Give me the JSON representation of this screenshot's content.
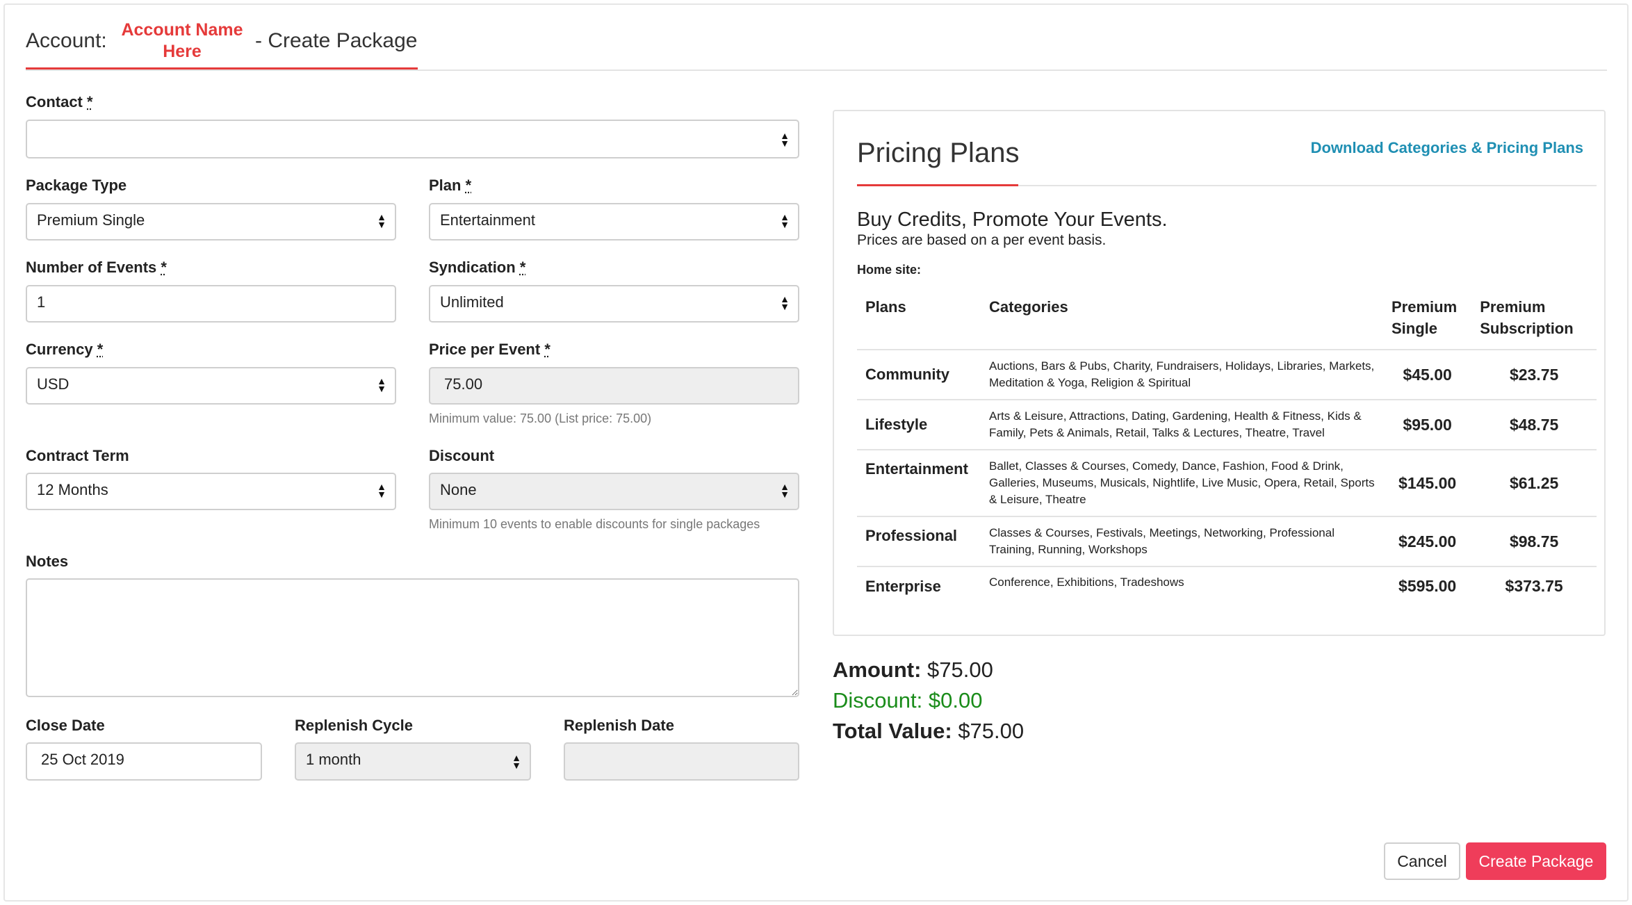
{
  "header": {
    "account_label": "Account:",
    "account_name": "Account Name Here",
    "title_suffix": "- Create Package"
  },
  "form": {
    "required_mark": "*",
    "contact": {
      "label": "Contact",
      "value": ""
    },
    "package_type": {
      "label": "Package Type",
      "value": "Premium Single"
    },
    "plan": {
      "label": "Plan",
      "value": "Entertainment"
    },
    "number_of_events": {
      "label": "Number of Events",
      "value": "1"
    },
    "syndication": {
      "label": "Syndication",
      "value": "Unlimited"
    },
    "currency": {
      "label": "Currency",
      "value": "USD"
    },
    "price_per_event": {
      "label": "Price per Event",
      "value": "75.00",
      "help": "Minimum value: 75.00 (List price: 75.00)"
    },
    "contract_term": {
      "label": "Contract Term",
      "value": "12 Months"
    },
    "discount": {
      "label": "Discount",
      "value": "None",
      "help": "Minimum 10 events to enable discounts for single packages"
    },
    "notes": {
      "label": "Notes",
      "value": ""
    },
    "close_date": {
      "label": "Close Date",
      "value": "25 Oct 2019"
    },
    "replenish_cycle": {
      "label": "Replenish Cycle",
      "value": "1 month"
    },
    "replenish_date": {
      "label": "Replenish Date",
      "value": ""
    }
  },
  "pricing": {
    "title": "Pricing Plans",
    "download_link": "Download Categories & Pricing Plans",
    "tagline": "Buy Credits, Promote Your Events.",
    "subtitle": "Prices are based on a per event basis.",
    "home_site": "Home site:",
    "columns": {
      "plans": "Plans",
      "categories": "Categories",
      "single_1": "Premium",
      "single_2": "Single",
      "subscription_1": "Premium",
      "subscription_2": "Subscription"
    },
    "rows": [
      {
        "plan": "Community",
        "categories": "Auctions, Bars & Pubs, Charity, Fundraisers, Holidays, Libraries, Markets, Meditation & Yoga, Religion & Spiritual",
        "single": "$45.00",
        "subscription": "$23.75"
      },
      {
        "plan": "Lifestyle",
        "categories": "Arts & Leisure, Attractions, Dating, Gardening, Health & Fitness, Kids & Family, Pets & Animals, Retail, Talks & Lectures, Theatre, Travel",
        "single": "$95.00",
        "subscription": "$48.75"
      },
      {
        "plan": "Entertainment",
        "categories": "Ballet, Classes & Courses, Comedy, Dance, Fashion, Food & Drink, Galleries, Museums, Musicals, Nightlife, Live Music, Opera, Retail, Sports & Leisure, Theatre",
        "single": "$145.00",
        "subscription": "$61.25"
      },
      {
        "plan": "Professional",
        "categories": "Classes & Courses, Festivals, Meetings, Networking, Professional Training, Running, Workshops",
        "single": "$245.00",
        "subscription": "$98.75"
      },
      {
        "plan": "Enterprise",
        "categories": "Conference, Exhibitions, Tradeshows",
        "single": "$595.00",
        "subscription": "$373.75"
      }
    ]
  },
  "totals": {
    "amount_label": "Amount:",
    "amount_value": "$75.00",
    "discount_label": "Discount:",
    "discount_value": "$0.00",
    "total_label": "Total Value:",
    "total_value": "$75.00"
  },
  "buttons": {
    "cancel": "Cancel",
    "create": "Create Package"
  },
  "colors": {
    "accent_red": "#e53a3a",
    "primary_button": "#ef3d5a",
    "link": "#1f8fb3",
    "discount_green": "#1a8c1a"
  }
}
